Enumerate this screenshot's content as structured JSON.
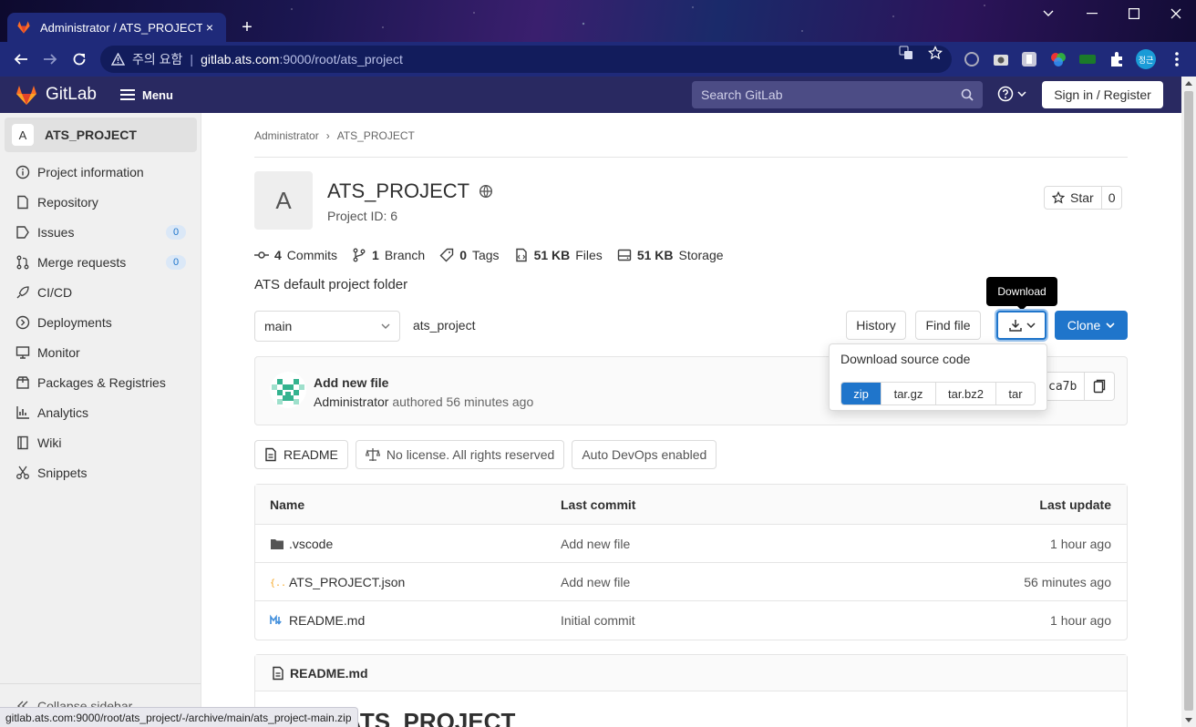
{
  "browser": {
    "tab_title": "Administrator / ATS_PROJECT · G",
    "tab_close": "×",
    "new_tab": "+",
    "security_label": "주의 요함",
    "url_host": "gitlab.ats.com",
    "url_path": ":9000/root/ats_project",
    "profile_label": "정근",
    "status_url": "gitlab.ats.com:9000/root/ats_project/-/archive/main/ats_project-main.zip"
  },
  "gitlab_header": {
    "brand": "GitLab",
    "menu_label": "Menu",
    "search_placeholder": "Search GitLab",
    "signin_label": "Sign in / Register"
  },
  "sidebar": {
    "project_initial": "A",
    "project_name": "ATS_PROJECT",
    "items": [
      {
        "label": "Project information",
        "icon": "info-icon"
      },
      {
        "label": "Repository",
        "icon": "doc-icon"
      },
      {
        "label": "Issues",
        "icon": "issues-icon",
        "count": "0"
      },
      {
        "label": "Merge requests",
        "icon": "merge-icon",
        "count": "0"
      },
      {
        "label": "CI/CD",
        "icon": "rocket-icon"
      },
      {
        "label": "Deployments",
        "icon": "deploy-icon"
      },
      {
        "label": "Monitor",
        "icon": "monitor-icon"
      },
      {
        "label": "Packages & Registries",
        "icon": "package-icon"
      },
      {
        "label": "Analytics",
        "icon": "chart-icon"
      },
      {
        "label": "Wiki",
        "icon": "book-icon"
      },
      {
        "label": "Snippets",
        "icon": "scissors-icon"
      }
    ],
    "collapse_label": "Collapse sidebar"
  },
  "breadcrumb": {
    "parent": "Administrator",
    "sep": "›",
    "current": "ATS_PROJECT"
  },
  "project": {
    "initial": "A",
    "title": "ATS_PROJECT",
    "id_text": "Project ID: 6",
    "star_label": "Star",
    "star_count": "0",
    "description": "ATS default project folder"
  },
  "stats": [
    {
      "value": "4",
      "label": "Commits"
    },
    {
      "value": "1",
      "label": "Branch"
    },
    {
      "value": "0",
      "label": "Tags"
    },
    {
      "value": "51 KB",
      "label": "Files"
    },
    {
      "value": "51 KB",
      "label": "Storage"
    }
  ],
  "toolbar": {
    "branch": "main",
    "path": "ats_project",
    "history": "History",
    "find_file": "Find file",
    "download_tooltip": "Download",
    "clone": "Clone"
  },
  "download_menu": {
    "title": "Download source code",
    "options": [
      "zip",
      "tar.gz",
      "tar.bz2",
      "tar"
    ],
    "selected": "zip"
  },
  "last_commit": {
    "title": "Add new file",
    "author": "Administrator",
    "meta": "authored 56 minutes ago",
    "sha": "ca7b"
  },
  "badges": [
    {
      "label": "README",
      "icon": "doc-icon"
    },
    {
      "label": "No license. All rights reserved",
      "icon": "scale-icon"
    },
    {
      "label": "Auto DevOps enabled"
    }
  ],
  "file_table": {
    "headers": {
      "name": "Name",
      "last_commit": "Last commit",
      "last_update": "Last update"
    },
    "rows": [
      {
        "name": ".vscode",
        "type": "folder-icon",
        "commit": "Add new file",
        "updated": "1 hour ago"
      },
      {
        "name": "ATS_PROJECT.json",
        "type": "json-icon",
        "commit": "Add new file",
        "updated": "56 minutes ago"
      },
      {
        "name": "README.md",
        "type": "markdown-icon",
        "commit": "Initial commit",
        "updated": "1 hour ago"
      }
    ]
  },
  "readme": {
    "filename": "README.md",
    "heading": "ATS_PROJECT"
  },
  "colors": {
    "header_bg": "#292961",
    "accent": "#1f75cb",
    "sidebar_bg": "#f0f0f0"
  }
}
